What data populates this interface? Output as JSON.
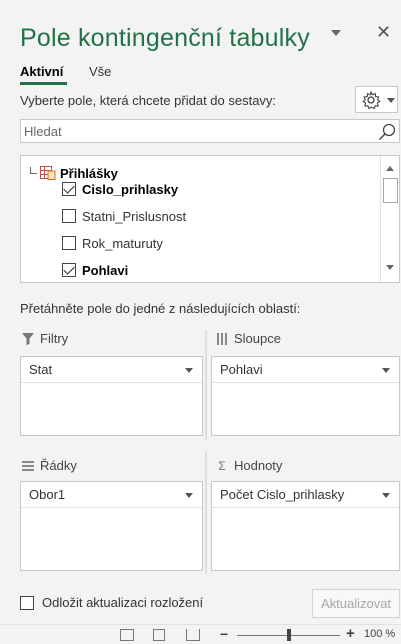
{
  "pane": {
    "title": "Pole kontingenční tabulky",
    "tabs": [
      {
        "label": "Aktivní",
        "active": true
      },
      {
        "label": "Vše",
        "active": false
      }
    ],
    "choose_hint": "Vyberte pole, která chcete přidat do sestavy:",
    "settings_icon": "gear-icon"
  },
  "search": {
    "placeholder": "Hledat",
    "value": ""
  },
  "field_list": {
    "table_name": "Přihlášky",
    "fields": [
      {
        "label": "Cislo_prihlasky",
        "checked": true
      },
      {
        "label": "Statni_Prislusnost",
        "checked": false
      },
      {
        "label": "Rok_maturuty",
        "checked": false
      },
      {
        "label": "Pohlavi",
        "checked": true
      }
    ]
  },
  "areas": {
    "drag_hint": "Přetáhněte pole do jedné z následujících oblastí:",
    "filters": {
      "label": "Filtry",
      "icon": "filter-icon",
      "items": [
        "Stat"
      ]
    },
    "columns": {
      "label": "Sloupce",
      "icon": "columns-icon",
      "items": [
        "Pohlavi"
      ]
    },
    "rows": {
      "label": "Řádky",
      "icon": "rows-icon",
      "items": [
        "Obor1"
      ]
    },
    "values": {
      "label": "Hodnoty",
      "icon": "sigma-icon",
      "items": [
        "Počet Cislo_prihlasky"
      ]
    }
  },
  "footer": {
    "defer_label": "Odložit aktualizaci rozložení",
    "defer_checked": false,
    "update_label": "Aktualizovat"
  },
  "status_bar": {
    "zoom": "100 %",
    "zoom_level": 0.5
  },
  "colors": {
    "accent": "#217346",
    "background": "#f3f3f3"
  }
}
